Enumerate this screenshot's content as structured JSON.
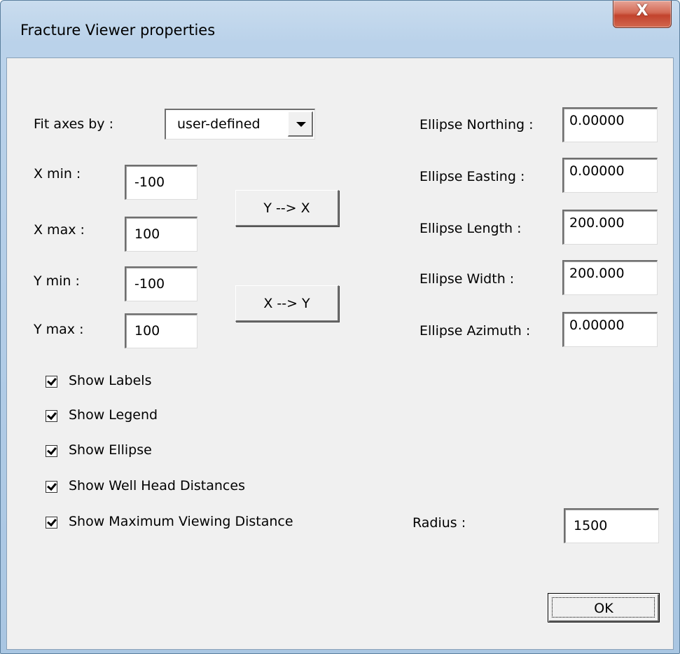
{
  "window": {
    "title": "Fracture Viewer properties",
    "close_glyph": "X"
  },
  "fit_axes": {
    "label": "Fit axes by :",
    "value": "user-defined"
  },
  "axes": {
    "x_min_label": "X min  :",
    "x_min": "-100",
    "x_max_label": "X max :",
    "x_max": "100",
    "y_min_label": "Y min  :",
    "y_min": "-100",
    "y_max_label": "Y max :",
    "y_max": "100"
  },
  "buttons": {
    "y_to_x": "Y --> X",
    "x_to_y": "X --> Y",
    "ok": "OK"
  },
  "ellipse": {
    "northing_label": "Ellipse Northing  :",
    "northing": "0.00000",
    "easting_label": "Ellipse Easting  :",
    "easting": "0.00000",
    "length_label": "Ellipse Length  :",
    "length": "200.000",
    "width_label": "Ellipse Width  :",
    "width": "200.000",
    "azimuth_label": "Ellipse Azimuth  :",
    "azimuth": "0.00000"
  },
  "checkboxes": [
    {
      "label": "Show Labels",
      "checked": true
    },
    {
      "label": "Show Legend",
      "checked": true
    },
    {
      "label": "Show Ellipse",
      "checked": true
    },
    {
      "label": "Show Well Head Distances",
      "checked": true
    },
    {
      "label": "Show Maximum Viewing Distance",
      "checked": true
    }
  ],
  "radius": {
    "label": "Radius :",
    "value": "1500"
  }
}
